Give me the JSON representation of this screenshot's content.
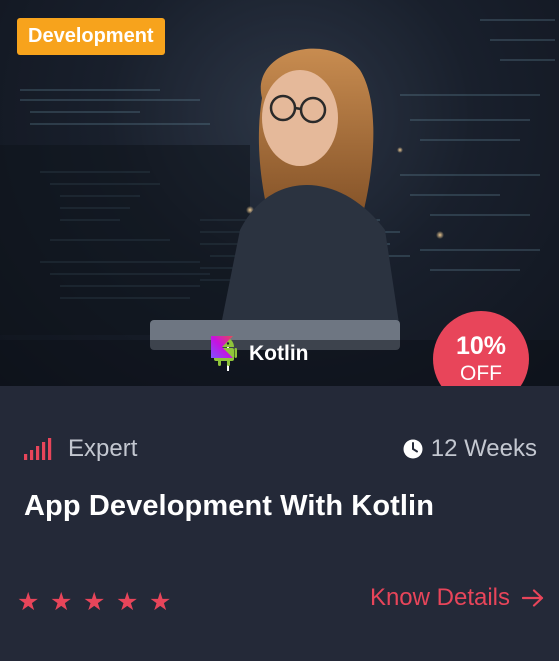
{
  "course": {
    "category": "Development",
    "tech_label": "Kotlin",
    "discount_percent": "10%",
    "discount_label": "OFF",
    "level": "Expert",
    "duration": "12 Weeks",
    "title": "App Development With Kotlin",
    "rating_stars": 5,
    "cta_label": "Know Details"
  },
  "icons": {
    "level": "signal-bars-icon",
    "duration": "clock-icon",
    "cta": "arrow-right-icon",
    "platform_1": "android-icon",
    "platform_2": "kotlin-logo-icon",
    "star": "star-icon"
  },
  "colors": {
    "card_bg": "#242938",
    "badge": "#f7a31c",
    "accent": "#e8455a",
    "android": "#8fc43a",
    "meta_text": "#c3c7d0"
  }
}
